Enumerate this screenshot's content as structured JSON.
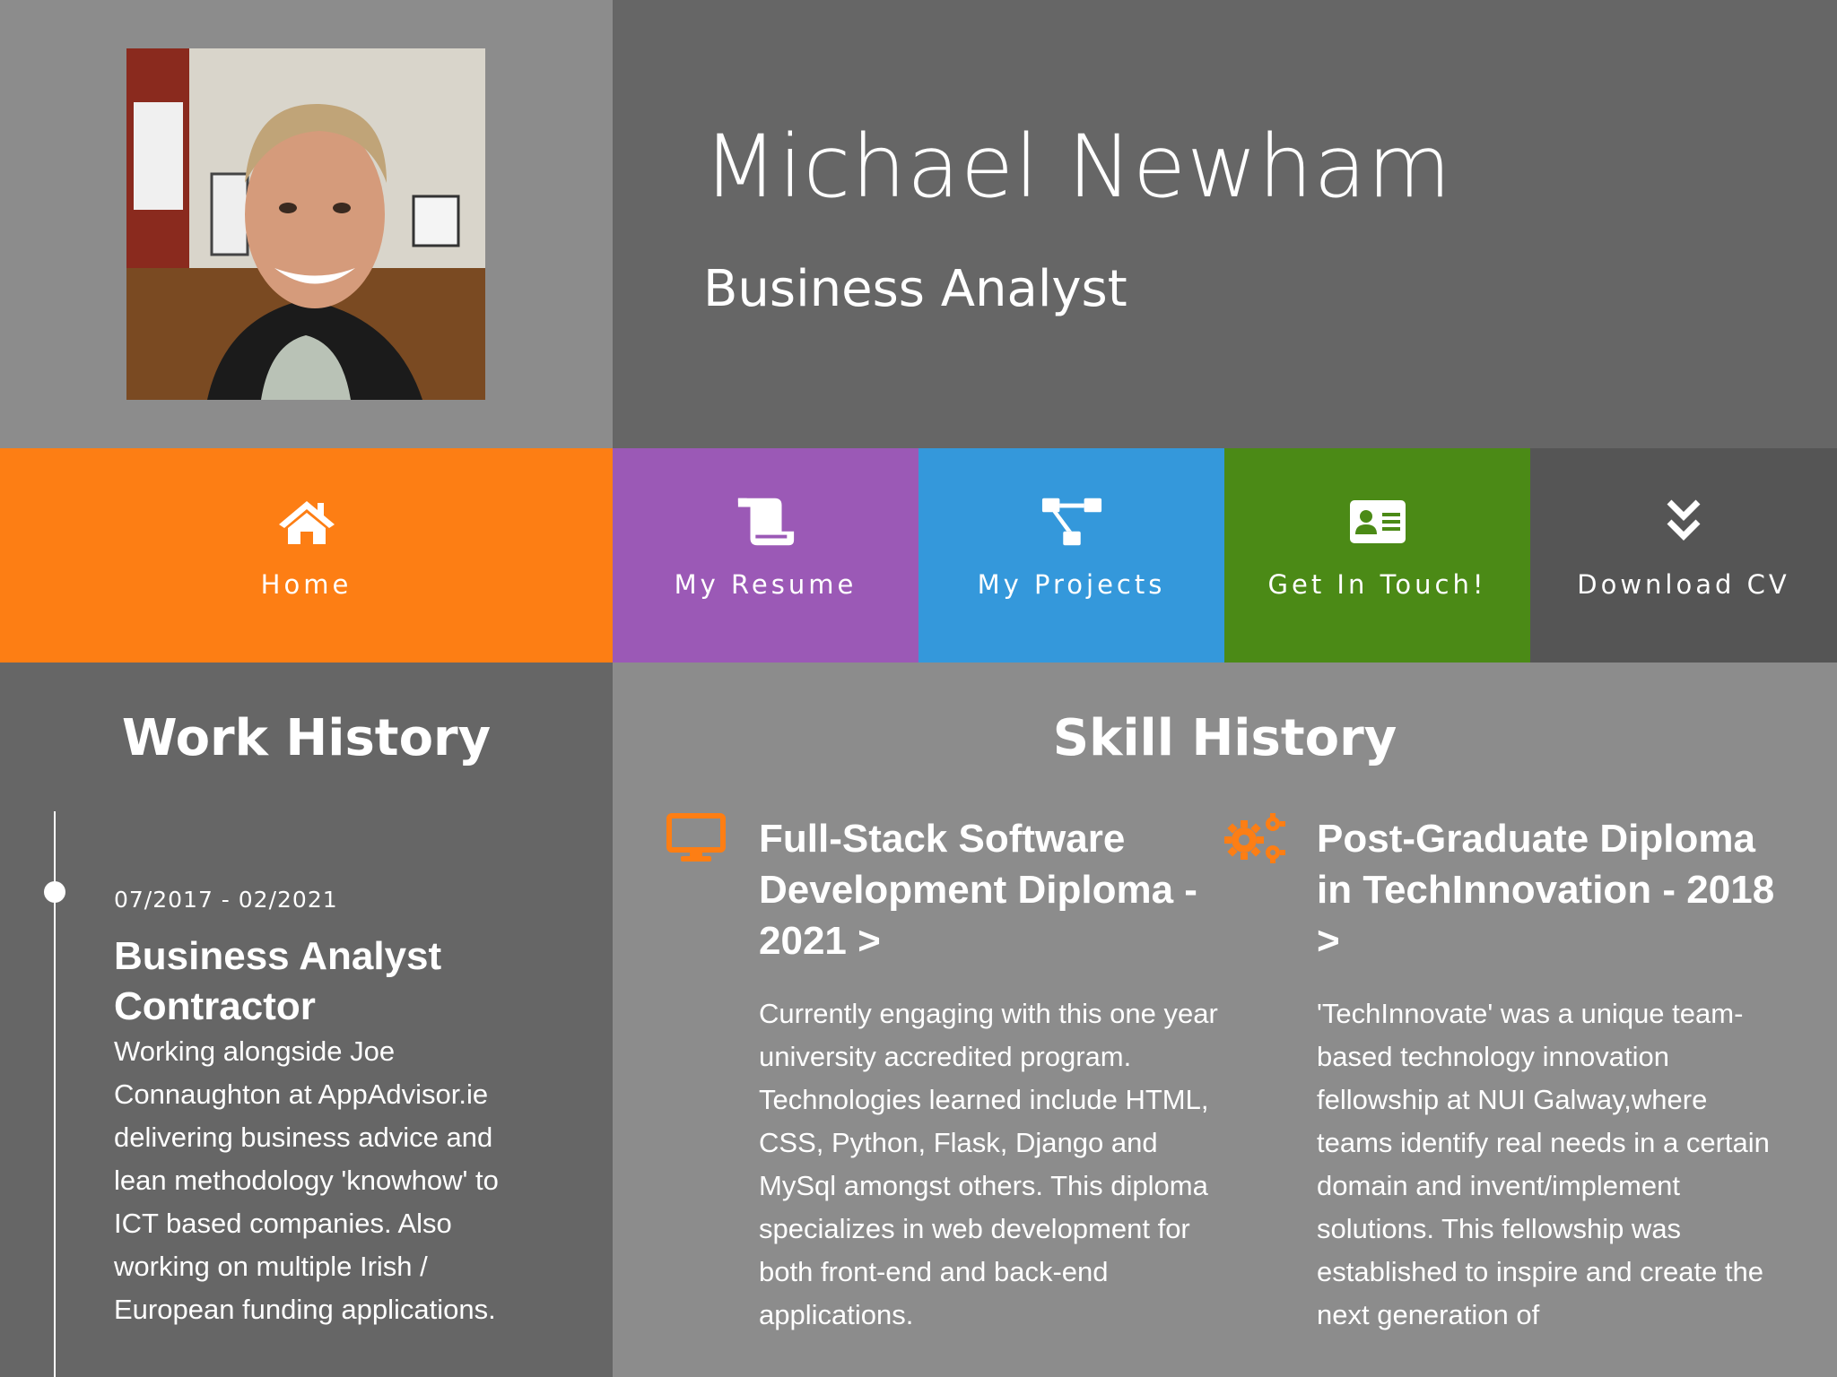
{
  "profile": {
    "name": "Michael Newham",
    "role": "Business Analyst"
  },
  "nav": {
    "items": [
      {
        "label": "Home",
        "icon": "home-icon",
        "color": "#fd7e14"
      },
      {
        "label": "My Resume",
        "icon": "scroll-icon",
        "color": "#9b59b6"
      },
      {
        "label": "My Projects",
        "icon": "project-diagram-icon",
        "color": "#3498db"
      },
      {
        "label": "Get In Touch!",
        "icon": "id-card-icon",
        "color": "#4b8a16"
      },
      {
        "label": "Download CV",
        "icon": "double-chevron-down-icon",
        "color": "#555555"
      }
    ]
  },
  "work": {
    "title": "Work History",
    "jobs": [
      {
        "date": "07/2017 - 02/2021",
        "title": "Business Analyst Contractor",
        "description": "Working alongside Joe Connaughton at AppAdvisor.ie delivering business advice and lean methodology 'knowhow' to ICT based companies. Also working on multiple Irish / European funding applications."
      }
    ]
  },
  "skills": {
    "title": "Skill History",
    "items": [
      {
        "icon": "desktop-icon",
        "title": "Full-Stack Software Development Diploma - 2021 >",
        "description": "Currently engaging with this one year university accredited program. Technologies learned include HTML, CSS, Python, Flask, Django and MySql amongst others. This diploma specializes in web development for both front-end and back-end applications."
      },
      {
        "icon": "cogs-icon",
        "title": "Post-Graduate Diploma in TechInnovation - 2018 >",
        "description": "'TechInnovate' was a unique team-based technology innovation fellowship at NUI Galway,where teams identify real needs in a certain domain and invent/implement solutions. This fellowship was established to inspire and create the next generation of"
      }
    ]
  },
  "colors": {
    "accent_orange": "#fd7e14",
    "header_dark": "#666666",
    "panel_grey": "#8c8c8c"
  }
}
